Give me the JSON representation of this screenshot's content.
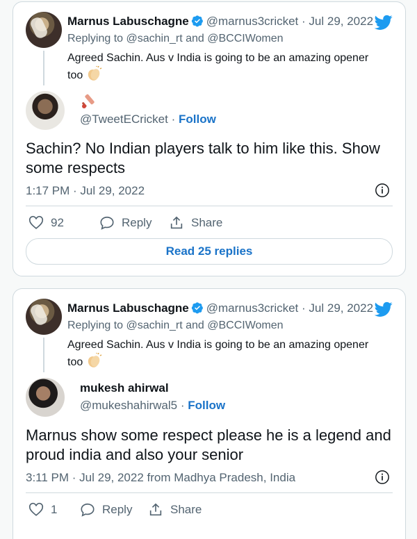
{
  "cards": [
    {
      "quoted": {
        "name": "Marnus Labuschagne",
        "handle": "@marnus3cricket",
        "separator": "·",
        "date": "Jul 29, 2022",
        "replying_to": "Replying to @sachin_rt and @BCCIWomen",
        "text_line1": "Agreed Sachin. Aus v India is going to be an amazing opener",
        "text_line2": "too"
      },
      "reply": {
        "handle": "@TweetECricket",
        "separator": "·",
        "follow": "Follow",
        "text": "Sachin? No Indian players talk to him like this. Show some respects",
        "meta": "1:17 PM · Jul 29, 2022"
      },
      "actions": {
        "likes": "92",
        "reply": "Reply",
        "share": "Share"
      },
      "read_replies": "Read 25 replies"
    },
    {
      "quoted": {
        "name": "Marnus Labuschagne",
        "handle": "@marnus3cricket",
        "separator": "·",
        "date": "Jul 29, 2022",
        "replying_to": "Replying to @sachin_rt and @BCCIWomen",
        "text_line1": "Agreed Sachin. Aus v India is going to be an amazing opener",
        "text_line2": "too"
      },
      "reply": {
        "name": "mukesh ahirwal",
        "handle": "@mukeshahirwal5",
        "separator": "·",
        "follow": "Follow",
        "text": "Marnus show some respect please he is a legend and proud india and also your senior",
        "meta": "3:11 PM · Jul 29, 2022 from Madhya Pradesh, India"
      },
      "actions": {
        "likes": "1",
        "reply": "Reply",
        "share": "Share"
      }
    }
  ],
  "colors": {
    "accent": "#1a73c8",
    "twitter_blue": "#1d9bf0",
    "muted": "#536471",
    "border": "#cfd9de"
  },
  "icons": [
    "verified-badge-icon",
    "twitter-bird-icon",
    "clapping-hands-icon",
    "cricket-bat-icon",
    "info-icon",
    "heart-icon",
    "reply-bubble-icon",
    "share-icon"
  ]
}
